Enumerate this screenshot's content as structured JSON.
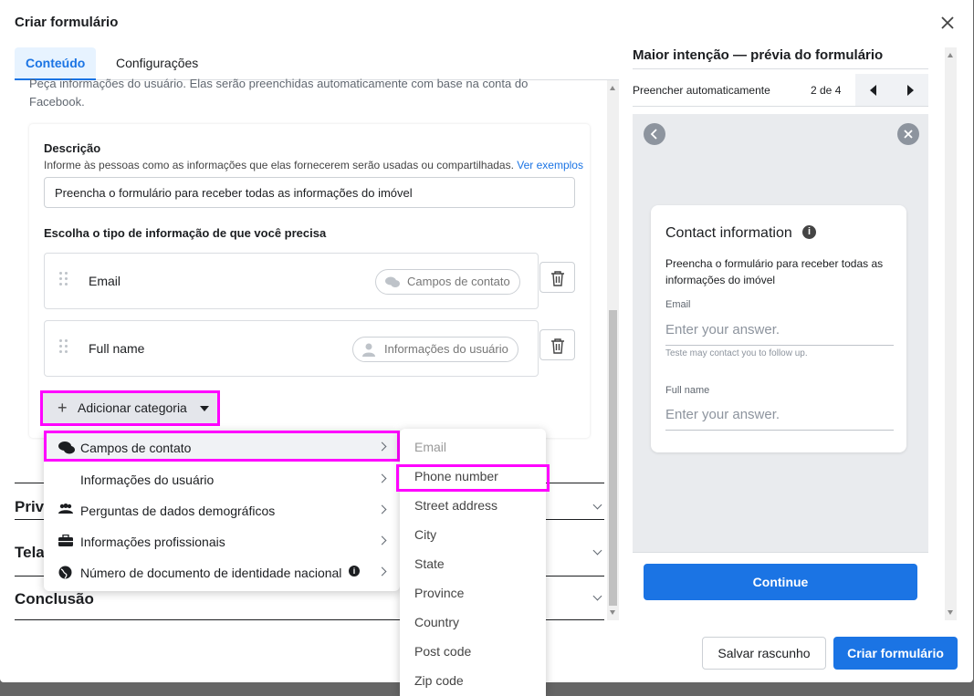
{
  "modal": {
    "title": "Criar formulário",
    "tabs": [
      "Conteúdo",
      "Configurações"
    ]
  },
  "left": {
    "intro": "Peça informações do usuário. Elas serão preenchidas automaticamente com base na conta do Facebook.",
    "description_label": "Descrição",
    "description_hint": "Informe às pessoas como as informações que elas fornecerem serão usadas ou compartilhadas.",
    "description_link": "Ver exemplos",
    "description_value": "Preencha o formulário para receber todas as informações do imóvel",
    "choose_label": "Escolha o tipo de informação de que você precisa",
    "fields": [
      {
        "name": "Email",
        "chip": "Campos de contato"
      },
      {
        "name": "Full name",
        "chip": "Informações do usuário"
      }
    ],
    "add_category": "Adicionar categoria",
    "sections": [
      "Priv",
      "Tela",
      "Conclusão"
    ]
  },
  "menu": {
    "items": [
      {
        "label": "Campos de contato",
        "icon": "chat-bubbles-icon"
      },
      {
        "label": "Informações do usuário",
        "icon": "user-icon"
      },
      {
        "label": "Perguntas de dados demográficos",
        "icon": "people-icon"
      },
      {
        "label": "Informações profissionais",
        "icon": "briefcase-icon"
      },
      {
        "label": "Número de documento de identidade nacional",
        "icon": "globe-icon"
      }
    ]
  },
  "submenu": {
    "items": [
      "Email",
      "Phone number",
      "Street address",
      "City",
      "State",
      "Province",
      "Country",
      "Post code",
      "Zip code"
    ]
  },
  "preview": {
    "heading": "Maior intenção — prévia do formulário",
    "subheading": "Preencher automaticamente",
    "page": "2 de 4",
    "card_title": "Contact information",
    "card_text": "Preencha o formulário para receber todas as informações do imóvel",
    "email_label": "Email",
    "email_placeholder": "Enter your answer.",
    "email_note": "Teste may contact you to follow up.",
    "name_label": "Full name",
    "name_placeholder": "Enter your answer.",
    "continue": "Continue"
  },
  "footer": {
    "draft": "Salvar rascunho",
    "create": "Criar formulário"
  },
  "colors": {
    "accent": "#1b74e4",
    "highlight": "#ff00ff"
  }
}
